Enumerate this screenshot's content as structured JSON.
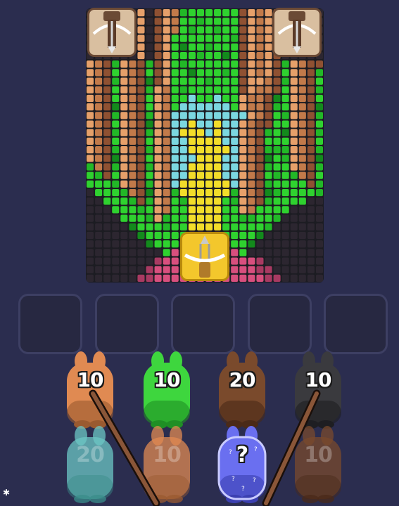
{
  "board": {
    "cols": 28,
    "rows": 32,
    "palette": {
      "G": "#2fd22f",
      "g": "#22b827",
      "d": "#138a1c",
      "b": "#2c2630",
      "o": "#e6a06a",
      "O": "#c27a4a",
      "r": "#8f5132",
      "c": "#7bd7e0",
      "y": "#f2dd2a",
      "p": "#d84f7e",
      "P": "#a93a62"
    },
    "grid": [
      "bbbbbbobroOgGGGGGGroOorbbbbb",
      "bbbbbbobroOGGgGGGGroOorbbbbb",
      "bbbbbbobroOGgGGgGGroOorbbbbb",
      "bbbbbbobroGGGGGGGgroOorbbbbb",
      "bbbbbbobroGdGGgGGGroOorbbbbb",
      "bbbbbbobroGGGgGGdGroOorbbbbb",
      "oOrgoOrgroGgGGGGGGroOorgoOrr",
      "oOrGoOrGroGGdGGGgGroOorGoOrg",
      "oOrgoOrdroGGGGgGGGrooOrgoOrG",
      "oOrGoOrgoOGgGGGGGGroOOrGoOrg",
      "oOrGoOrGoOGGcGGcGGoOOrdGoOrG",
      "oOrdoOrGoOGccccccGoOOrgGoOrd",
      "oOrgoOrgoOcccccccccoOrGgoOrg",
      "oOrGoOrdoOccyccyccoOrrGGoOrG",
      "oOrgoOrgoOcyyycyccoOrgGdoOrg",
      "oOrGoOrGoOccyyyyccoOrGGGoOrG",
      "oOrgoOrgoOccyyyyycoOrgggoOrg",
      "oOrdoOrGoOcccyyyccoOrdGgoOrd",
      "gOrgoOrgoOccyyyyccoOrgGGoOrg",
      "GgrGoOrGoOccyyyyccoOrGgGgOrG",
      "GGGgoOrgoOcyyyyyycoOrgGGGGrg",
      "bGGGgOrdoOgyyyyyygoOrdgGGGGg",
      "bbGGGgrgoOGgyyyyGgoOrgGGGGbb",
      "bbbGGGgGoOGGyyyyGGoOGGGGbbbb",
      "bbbbGGGgogGGyyyyGGggGGgbbbbb",
      "bbbbbdGGGgGGyyyyGGGGGgbbbbbb",
      "bbbbbbdGGGGGppppGGGGdbbbbbbb",
      "bbbbbbbdGGGppppppGGdbbbbbbbb",
      "bbbbbbbbbGppppppppGbbbbbbbbb",
      "bbbbbbbbPpppppppppppPbbbbbbb",
      "bbbbbbbPppppppppppppPPbbbbbb",
      "bbbbbbPPpppppppppppppPPbbbbb"
    ]
  },
  "turrets": [
    {
      "name": "turret-top-left",
      "color": "#f0e3c8"
    },
    {
      "name": "turret-top-right",
      "color": "#f0e3c8"
    },
    {
      "name": "turret-bottom-active",
      "color": "#f3c72c"
    }
  ],
  "slots": [
    {
      "id": 1
    },
    {
      "id": 2
    },
    {
      "id": 3
    },
    {
      "id": 4
    },
    {
      "id": 5
    }
  ],
  "bunnies": {
    "row1": [
      {
        "count": "10",
        "color": "#e08a52",
        "dark": "#9a5a30"
      },
      {
        "count": "10",
        "color": "#3ed63e",
        "dark": "#1f8f25"
      },
      {
        "count": "20",
        "color": "#7a4a2c",
        "dark": "#4a2a18"
      },
      {
        "count": "10",
        "color": "#3a3a3e",
        "dark": "#1e1e22"
      }
    ],
    "row2": [
      {
        "count": "20",
        "color": "#6cc7c4",
        "dark": "#3a8c8a"
      },
      {
        "count": "10",
        "color": "#e08a52",
        "dark": "#9a5a30"
      },
      {
        "count": "?",
        "color": "#6a6ff0",
        "dark": "#3b3fb0"
      },
      {
        "count": "10",
        "color": "#7a4a2c",
        "dark": "#4a2a18"
      }
    ]
  }
}
